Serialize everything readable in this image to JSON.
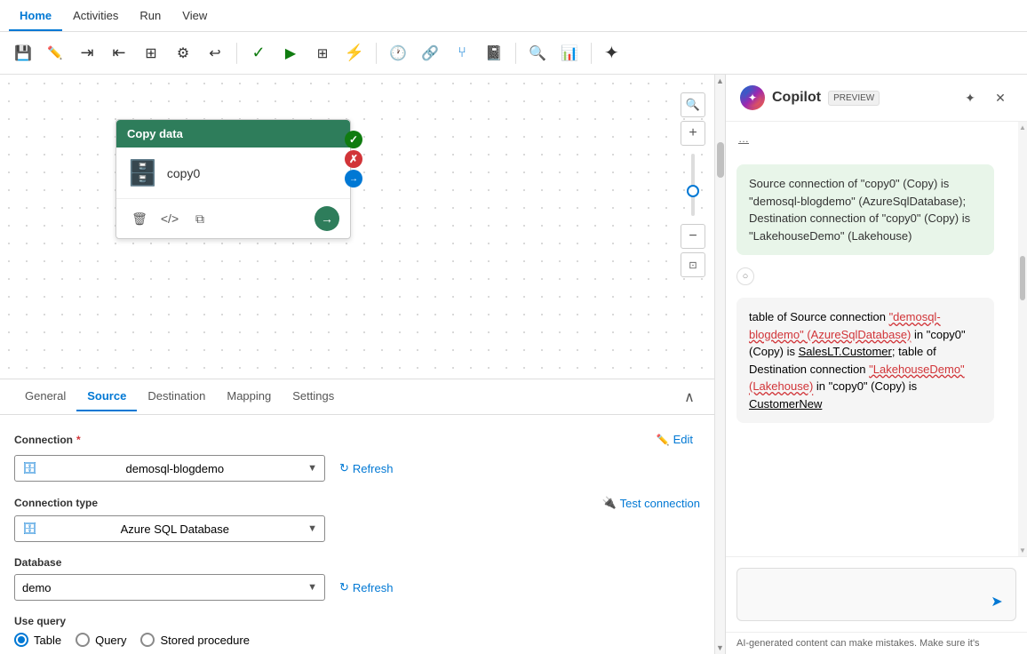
{
  "menu": {
    "items": [
      {
        "label": "Home",
        "active": true
      },
      {
        "label": "Activities",
        "active": false
      },
      {
        "label": "Run",
        "active": false
      },
      {
        "label": "View",
        "active": false
      }
    ]
  },
  "toolbar": {
    "buttons": [
      {
        "name": "save-btn",
        "icon": "💾",
        "tooltip": "Save"
      },
      {
        "name": "edit-btn",
        "icon": "✏️",
        "tooltip": "Edit"
      },
      {
        "name": "indent-btn",
        "icon": "⇥",
        "tooltip": "Indent"
      },
      {
        "name": "outdent-btn",
        "icon": "↦",
        "tooltip": "Outdent"
      },
      {
        "name": "fit-btn",
        "icon": "⊞",
        "tooltip": "Fit"
      },
      {
        "name": "settings-btn",
        "icon": "⚙",
        "tooltip": "Settings"
      },
      {
        "name": "undo-btn",
        "icon": "↩",
        "tooltip": "Undo"
      },
      {
        "name": "validate-btn",
        "icon": "✓",
        "tooltip": "Validate",
        "class": "validate"
      },
      {
        "name": "run-btn",
        "icon": "▶",
        "tooltip": "Run",
        "class": "run"
      },
      {
        "name": "table-btn",
        "icon": "⊞",
        "tooltip": "Table"
      },
      {
        "name": "trigger-btn",
        "icon": "⚡",
        "tooltip": "Trigger"
      },
      {
        "name": "history-btn",
        "icon": "🕐",
        "tooltip": "History"
      },
      {
        "name": "connect-btn",
        "icon": "🔗",
        "tooltip": "Connect"
      },
      {
        "name": "branch-btn",
        "icon": "⑂",
        "tooltip": "Branch"
      },
      {
        "name": "notebook-btn",
        "icon": "📓",
        "tooltip": "Notebook"
      },
      {
        "name": "search-btn",
        "icon": "🔍",
        "tooltip": "Search"
      },
      {
        "name": "monitor-btn",
        "icon": "📊",
        "tooltip": "Monitor"
      },
      {
        "name": "copilot-btn",
        "icon": "✦",
        "tooltip": "Copilot"
      }
    ]
  },
  "canvas": {
    "activity": {
      "title": "Copy data",
      "name": "copy0",
      "statusCheck": "✓",
      "statusX": "✗"
    }
  },
  "bottom_panel": {
    "tabs": [
      {
        "label": "General",
        "active": false
      },
      {
        "label": "Source",
        "active": true
      },
      {
        "label": "Destination",
        "active": false
      },
      {
        "label": "Mapping",
        "active": false
      },
      {
        "label": "Settings",
        "active": false
      }
    ],
    "source": {
      "connection_label": "Connection",
      "connection_required": "*",
      "connection_value": "demosql-blogdemo",
      "edit_label": "Edit",
      "refresh_label": "Refresh",
      "connection_type_label": "Connection type",
      "connection_type_value": "Azure SQL Database",
      "test_connection_label": "Test connection",
      "database_label": "Database",
      "database_value": "demo",
      "database_refresh_label": "Refresh",
      "use_query_label": "Use query",
      "query_options": [
        {
          "label": "Table",
          "value": "table",
          "checked": true
        },
        {
          "label": "Query",
          "value": "query",
          "checked": false
        },
        {
          "label": "Stored procedure",
          "value": "stored_procedure",
          "checked": false
        }
      ]
    }
  },
  "copilot": {
    "title": "Copilot",
    "preview_badge": "PREVIEW",
    "messages": [
      {
        "type": "assistant",
        "text": "Source connection of \"copy0\" (Copy) is \"demosql-blogdemo\" (AzureSqlDatabase); Destination connection of \"copy0\" (Copy) is \"LakehouseDemo\" (Lakehouse)"
      },
      {
        "type": "user",
        "text_parts": [
          {
            "type": "normal",
            "text": "table of Source connection "
          },
          {
            "type": "link_red",
            "text": "\"demosql-blogdemo\" (AzureSqlDatabase)"
          },
          {
            "type": "normal",
            "text": " in \"copy0\" (Copy) is "
          },
          {
            "type": "underline",
            "text": "SalesLT.Customer"
          },
          {
            "type": "normal",
            "text": "; table of Destination connection "
          },
          {
            "type": "link_red",
            "text": "\"LakehouseDemo\" (Lakehouse)"
          },
          {
            "type": "normal",
            "text": " in \"copy0\" (Copy) is "
          },
          {
            "type": "underline",
            "text": "CustomerNew"
          }
        ]
      }
    ],
    "input_placeholder": "",
    "disclaimer": "AI-generated content can make mistakes. Make sure it's"
  }
}
